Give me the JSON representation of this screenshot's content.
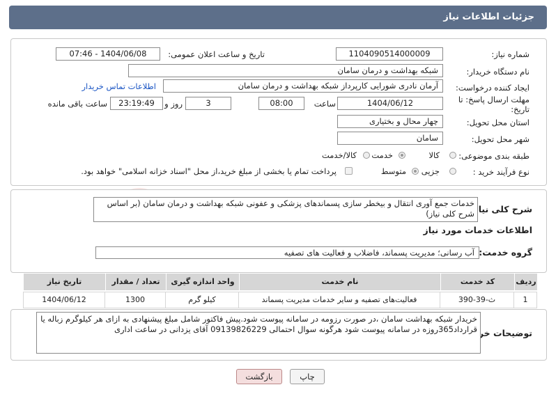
{
  "header": {
    "title": "جزئیات اطلاعات نیاز"
  },
  "form": {
    "need_number_label": "شماره نیاز:",
    "need_number": "1104090514000009",
    "announce_label": "تاریخ و ساعت اعلان عمومی:",
    "announce_value": "1404/06/08 - 07:46",
    "buyer_org_label": "نام دستگاه خریدار:",
    "buyer_org": "شبکه بهداشت و درمان سامان",
    "creator_label": "ایجاد کننده درخواست:",
    "creator": "آرمان نادری شورایی کارپرداز شبکه بهداشت و درمان سامان",
    "contact_link": "اطلاعات تماس خریدار",
    "deadline_label": "مهلت ارسال پاسخ: تا",
    "deadline_label2": "تاریخ:",
    "deadline_date": "1404/06/12",
    "time_label": "ساعت",
    "deadline_time": "08:00",
    "days_value": "3",
    "days_label": "روز و",
    "remaining_time": "23:19:49",
    "remaining_label": "ساعت باقی مانده",
    "province_label": "استان محل تحویل:",
    "province": "چهار محال و بختیاری",
    "city_label": "شهر محل تحویل:",
    "city": "سامان",
    "category_label": "طبقه بندی موضوعی:",
    "category_options": [
      "کالا",
      "خدمت",
      "کالا/خدمت"
    ],
    "category_selected": "خدمت",
    "process_label": "نوع فرآیند خرید :",
    "process_options": [
      "جزیی",
      "متوسط"
    ],
    "process_selected": "متوسط",
    "payment_note": "پرداخت تمام یا بخشی از مبلغ خرید،از محل \"اسناد خزانه اسلامی\" خواهد بود."
  },
  "summary": {
    "label": "شرح کلی نیاز:",
    "text": "خدمات جمع آوری انتقال و بیخطر سازی پسماندهای پزشکی و عفونی شبکه بهداشت و درمان سامان (بر اساس شرح کلی نیاز)"
  },
  "services": {
    "section_title": "اطلاعات خدمات مورد نیاز",
    "group_label": "گروه خدمت:",
    "group_value": "آب رسانی؛ مدیریت پسماند، فاضلاب و فعالیت های تصفیه",
    "columns": [
      "ردیف",
      "کد خدمت",
      "نام خدمت",
      "واحد اندازه گیری",
      "تعداد / مقدار",
      "تاریخ نیاز"
    ],
    "rows": [
      [
        "1",
        "ث-39-390",
        "فعالیت‌های تصفیه و سایر خدمات مدیریت پسماند",
        "کیلو گرم",
        "1300",
        "1404/06/12"
      ]
    ]
  },
  "buyer_notes": {
    "label": "توضیحات خریدار:",
    "text": "خریدار شبکه بهداشت سامان ،در صورت رزومه در سامانه پیوست شود.پیش فاکتور شامل مبلغ پیشنهادی به ازای هر کیلوگرم زباله یا قرارداد365روزه در سامانه پیوست شود هرگونه سوال احتمالی 09139826229 آقای یزدانی در ساعت اداری"
  },
  "buttons": {
    "print": "چاپ",
    "back": "بازگشت"
  },
  "watermark": "AriaTender.net"
}
